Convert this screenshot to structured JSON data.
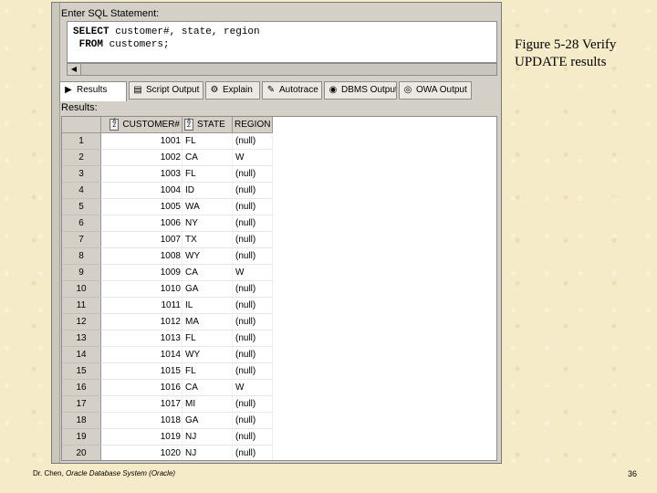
{
  "editor": {
    "label": "Enter SQL Statement:",
    "line1_keyword": "SELECT",
    "line1_rest": " customer#, state, region",
    "line2_keyword": " FROM",
    "line2_rest": " customers;"
  },
  "tabs": [
    {
      "label": "Results",
      "icon": "grid-icon",
      "active": true
    },
    {
      "label": "Script Output",
      "icon": "script-icon"
    },
    {
      "label": "Explain",
      "icon": "explain-icon"
    },
    {
      "label": "Autotrace",
      "icon": "autotrace-icon"
    },
    {
      "label": "DBMS Output",
      "icon": "dbms-icon"
    },
    {
      "label": "OWA Output",
      "icon": "owa-icon"
    }
  ],
  "results_label": "Results:",
  "table": {
    "columns": [
      "CUSTOMER#",
      "STATE",
      "REGION"
    ],
    "rows": [
      [
        "1",
        "1001",
        "FL",
        "(null)"
      ],
      [
        "2",
        "1002",
        "CA",
        "W"
      ],
      [
        "3",
        "1003",
        "FL",
        "(null)"
      ],
      [
        "4",
        "1004",
        "ID",
        "(null)"
      ],
      [
        "5",
        "1005",
        "WA",
        "(null)"
      ],
      [
        "6",
        "1006",
        "NY",
        "(null)"
      ],
      [
        "7",
        "1007",
        "TX",
        "(null)"
      ],
      [
        "8",
        "1008",
        "WY",
        "(null)"
      ],
      [
        "9",
        "1009",
        "CA",
        "W"
      ],
      [
        "10",
        "1010",
        "GA",
        "(null)"
      ],
      [
        "11",
        "1011",
        "IL",
        "(null)"
      ],
      [
        "12",
        "1012",
        "MA",
        "(null)"
      ],
      [
        "13",
        "1013",
        "FL",
        "(null)"
      ],
      [
        "14",
        "1014",
        "WY",
        "(null)"
      ],
      [
        "15",
        "1015",
        "FL",
        "(null)"
      ],
      [
        "16",
        "1016",
        "CA",
        "W"
      ],
      [
        "17",
        "1017",
        "MI",
        "(null)"
      ],
      [
        "18",
        "1018",
        "GA",
        "(null)"
      ],
      [
        "19",
        "1019",
        "NJ",
        "(null)"
      ],
      [
        "20",
        "1020",
        "NJ",
        "(null)"
      ]
    ]
  },
  "caption": "Figure 5-28 Verify UPDATE results",
  "footer": {
    "author": "Dr. Chen, ",
    "title": "Oracle Database System (Oracle)"
  },
  "page_number": "36"
}
